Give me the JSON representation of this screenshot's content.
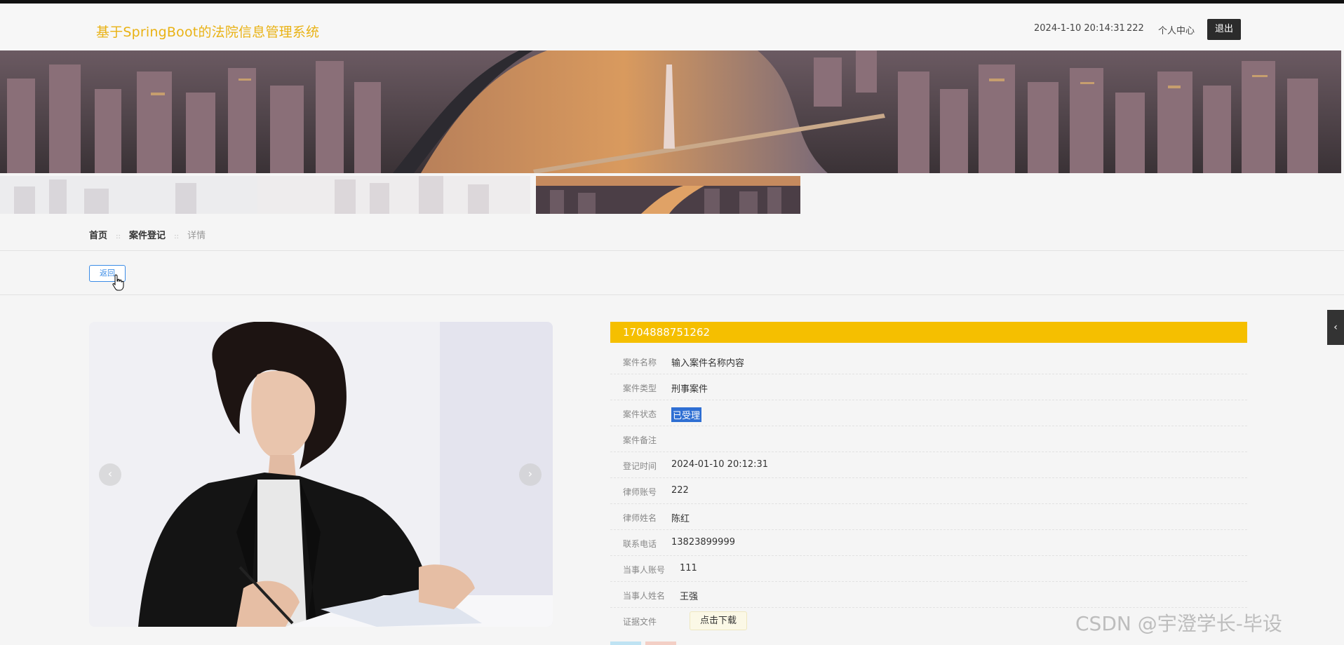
{
  "header": {
    "site_title": "基于SpringBoot的法院信息管理系统",
    "datetime": "2024-1-10 20:14:31",
    "username": "222",
    "profile_link": "个人中心",
    "logout_label": "退出"
  },
  "breadcrumb": {
    "home": "首页",
    "sep1": "::",
    "section": "案件登记",
    "sep2": "::",
    "current": "详情"
  },
  "back_label": "返回",
  "carousel": {
    "prev_icon": "chevron-left-icon",
    "next_icon": "chevron-right-icon",
    "prev_glyph": "‹",
    "next_glyph": "›"
  },
  "detail": {
    "case_number": "1704888751262",
    "fields": [
      {
        "label": "案件名称",
        "value": "输入案件名称内容"
      },
      {
        "label": "案件类型",
        "value": "刑事案件"
      },
      {
        "label": "案件状态",
        "value": "已受理"
      },
      {
        "label": "案件备注",
        "value": ""
      },
      {
        "label": "登记时间",
        "value": "2024-01-10 20:12:31"
      },
      {
        "label": "律师账号",
        "value": "222"
      },
      {
        "label": "律师姓名",
        "value": "陈红"
      },
      {
        "label": "联系电话",
        "value": "13823899999"
      },
      {
        "label": "当事人账号",
        "value": "111"
      },
      {
        "label": "当事人姓名",
        "value": "王强"
      },
      {
        "label": "证据文件",
        "value": "点击下载"
      }
    ]
  },
  "side_tab_glyph": "‹",
  "watermark": "CSDN @宇澄学长-毕设",
  "colors": {
    "accent": "#f5bf00",
    "title": "#e9b214",
    "link_blue": "#3b8ce6",
    "dark": "#2b2b2b"
  }
}
